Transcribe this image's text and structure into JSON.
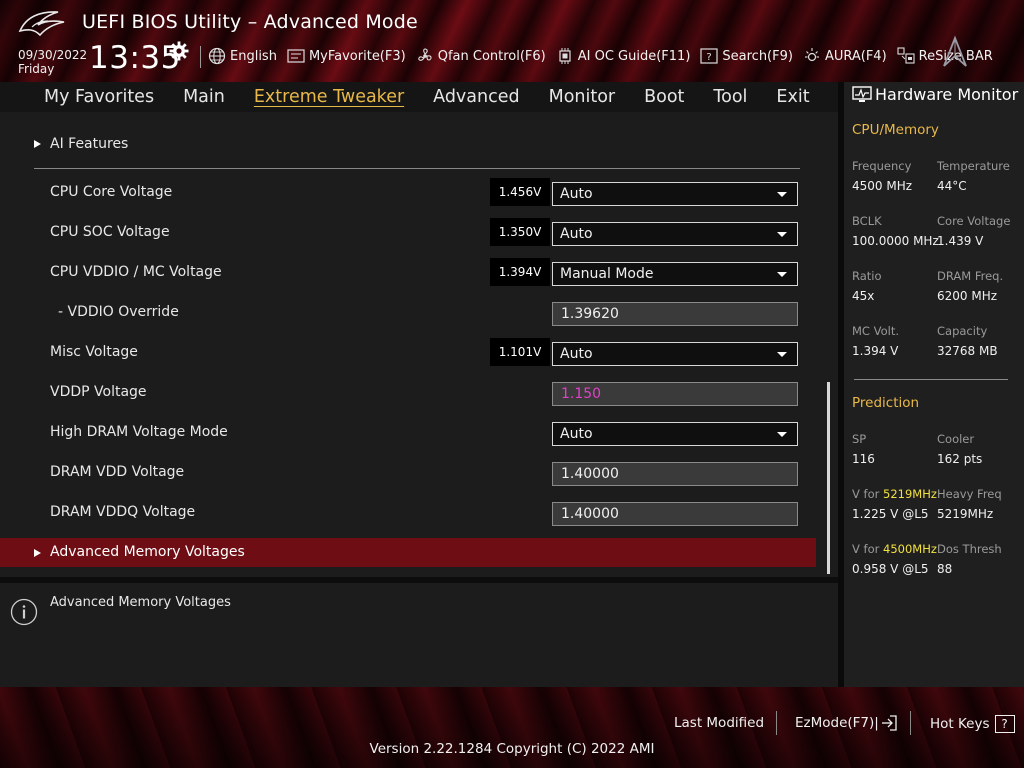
{
  "header": {
    "title": "UEFI BIOS Utility – Advanced Mode",
    "date": "09/30/2022",
    "day": "Friday",
    "time": "13:35",
    "toolbar": [
      {
        "label": "English",
        "icon": "globe-icon"
      },
      {
        "label": "MyFavorite(F3)",
        "icon": "favorite-icon"
      },
      {
        "label": "Qfan Control(F6)",
        "icon": "fan-icon"
      },
      {
        "label": "AI OC Guide(F11)",
        "icon": "chip-icon"
      },
      {
        "label": "Search(F9)",
        "icon": "search-icon"
      },
      {
        "label": "AURA(F4)",
        "icon": "aura-icon"
      },
      {
        "label": "ReSize BAR",
        "icon": "resize-bar-icon"
      }
    ]
  },
  "menu": {
    "items": [
      "My Favorites",
      "Main",
      "Extreme Tweaker",
      "Advanced",
      "Monitor",
      "Boot",
      "Tool",
      "Exit"
    ],
    "active": "Extreme Tweaker"
  },
  "main": {
    "submenu": "AI Features",
    "rows": [
      {
        "label": "CPU Core Voltage",
        "badge": "1.456V",
        "type": "select",
        "value": "Auto"
      },
      {
        "label": "CPU SOC Voltage",
        "badge": "1.350V",
        "type": "select",
        "value": "Auto"
      },
      {
        "label": "CPU VDDIO / MC Voltage",
        "badge": "1.394V",
        "type": "select",
        "value": "Manual Mode"
      },
      {
        "label": "- VDDIO Override",
        "badge": "",
        "type": "input",
        "value": "1.39620"
      },
      {
        "label": "Misc Voltage",
        "badge": "1.101V",
        "type": "select",
        "value": "Auto"
      },
      {
        "label": "VDDP Voltage",
        "badge": "",
        "type": "input-disabled",
        "value": "1.150"
      },
      {
        "label": "High DRAM Voltage Mode",
        "badge": "",
        "type": "select",
        "value": "Auto"
      },
      {
        "label": "DRAM VDD Voltage",
        "badge": "",
        "type": "input",
        "value": "1.40000"
      },
      {
        "label": "DRAM VDDQ Voltage",
        "badge": "",
        "type": "input",
        "value": "1.40000"
      }
    ],
    "selected_item": "Advanced Memory Voltages",
    "disabled_value_color": "#e041c8",
    "selected_row_color": "#6e0e14"
  },
  "help": {
    "text": "Advanced Memory Voltages"
  },
  "hardware_monitor": {
    "title": "Hardware Monitor",
    "cpu_memory": {
      "heading": "CPU/Memory",
      "items": [
        {
          "label": "Frequency",
          "value": "4500 MHz"
        },
        {
          "label": "Temperature",
          "value": "44°C"
        },
        {
          "label": "BCLK",
          "value": "100.0000 MHz"
        },
        {
          "label": "Core Voltage",
          "value": "1.439 V"
        },
        {
          "label": "Ratio",
          "value": "45x"
        },
        {
          "label": "DRAM Freq.",
          "value": "6200 MHz"
        },
        {
          "label": "MC Volt.",
          "value": "1.394 V"
        },
        {
          "label": "Capacity",
          "value": "32768 MB"
        }
      ]
    },
    "prediction": {
      "heading": "Prediction",
      "sp_label": "SP",
      "sp_value": "116",
      "cooler_label": "Cooler",
      "cooler_value": "162 pts",
      "v_for_label": "V for",
      "freq1": "5219MHz",
      "v1": "1.225 V @L5",
      "heavy_freq_label": "Heavy Freq",
      "heavy_freq_value": "5219MHz",
      "freq2": "4500MHz",
      "v2": "0.958 V @L5",
      "dos_thresh_label": "Dos Thresh",
      "dos_thresh_value": "88"
    },
    "accent_color": "#e8b84a",
    "highlight_color": "#f0e040"
  },
  "footer": {
    "last_modified": "Last Modified",
    "ezmode": "EzMode(F7)|",
    "hot_keys": "Hot Keys",
    "hot_keys_key": "?",
    "version": "Version 2.22.1284 Copyright (C) 2022 AMI"
  }
}
